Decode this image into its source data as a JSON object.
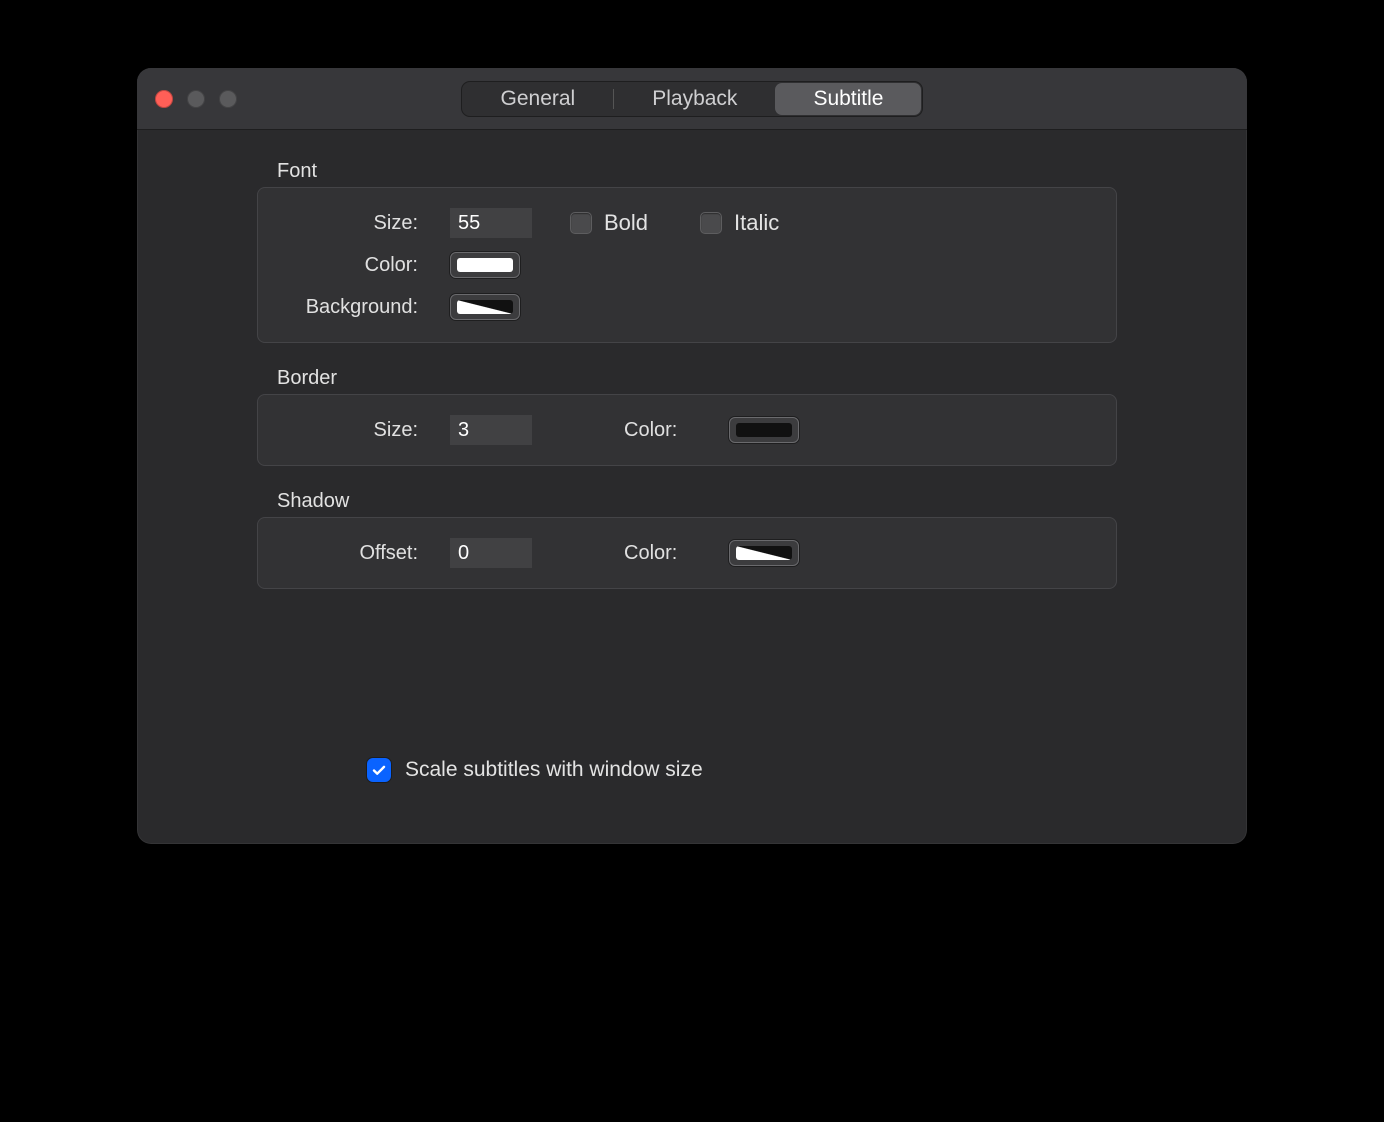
{
  "tabs": {
    "general": "General",
    "playback": "Playback",
    "subtitle": "Subtitle",
    "active": "subtitle"
  },
  "font": {
    "section": "Font",
    "size_label": "Size:",
    "size_value": "55",
    "bold_label": "Bold",
    "bold_checked": false,
    "italic_label": "Italic",
    "italic_checked": false,
    "color_label": "Color:",
    "color_value": "#ffffff",
    "background_label": "Background:",
    "background_value": "split"
  },
  "border": {
    "section": "Border",
    "size_label": "Size:",
    "size_value": "3",
    "color_label": "Color:",
    "color_value": "#111111"
  },
  "shadow": {
    "section": "Shadow",
    "offset_label": "Offset:",
    "offset_value": "0",
    "color_label": "Color:",
    "color_value": "split"
  },
  "scale": {
    "label": "Scale subtitles with window size",
    "checked": true
  }
}
